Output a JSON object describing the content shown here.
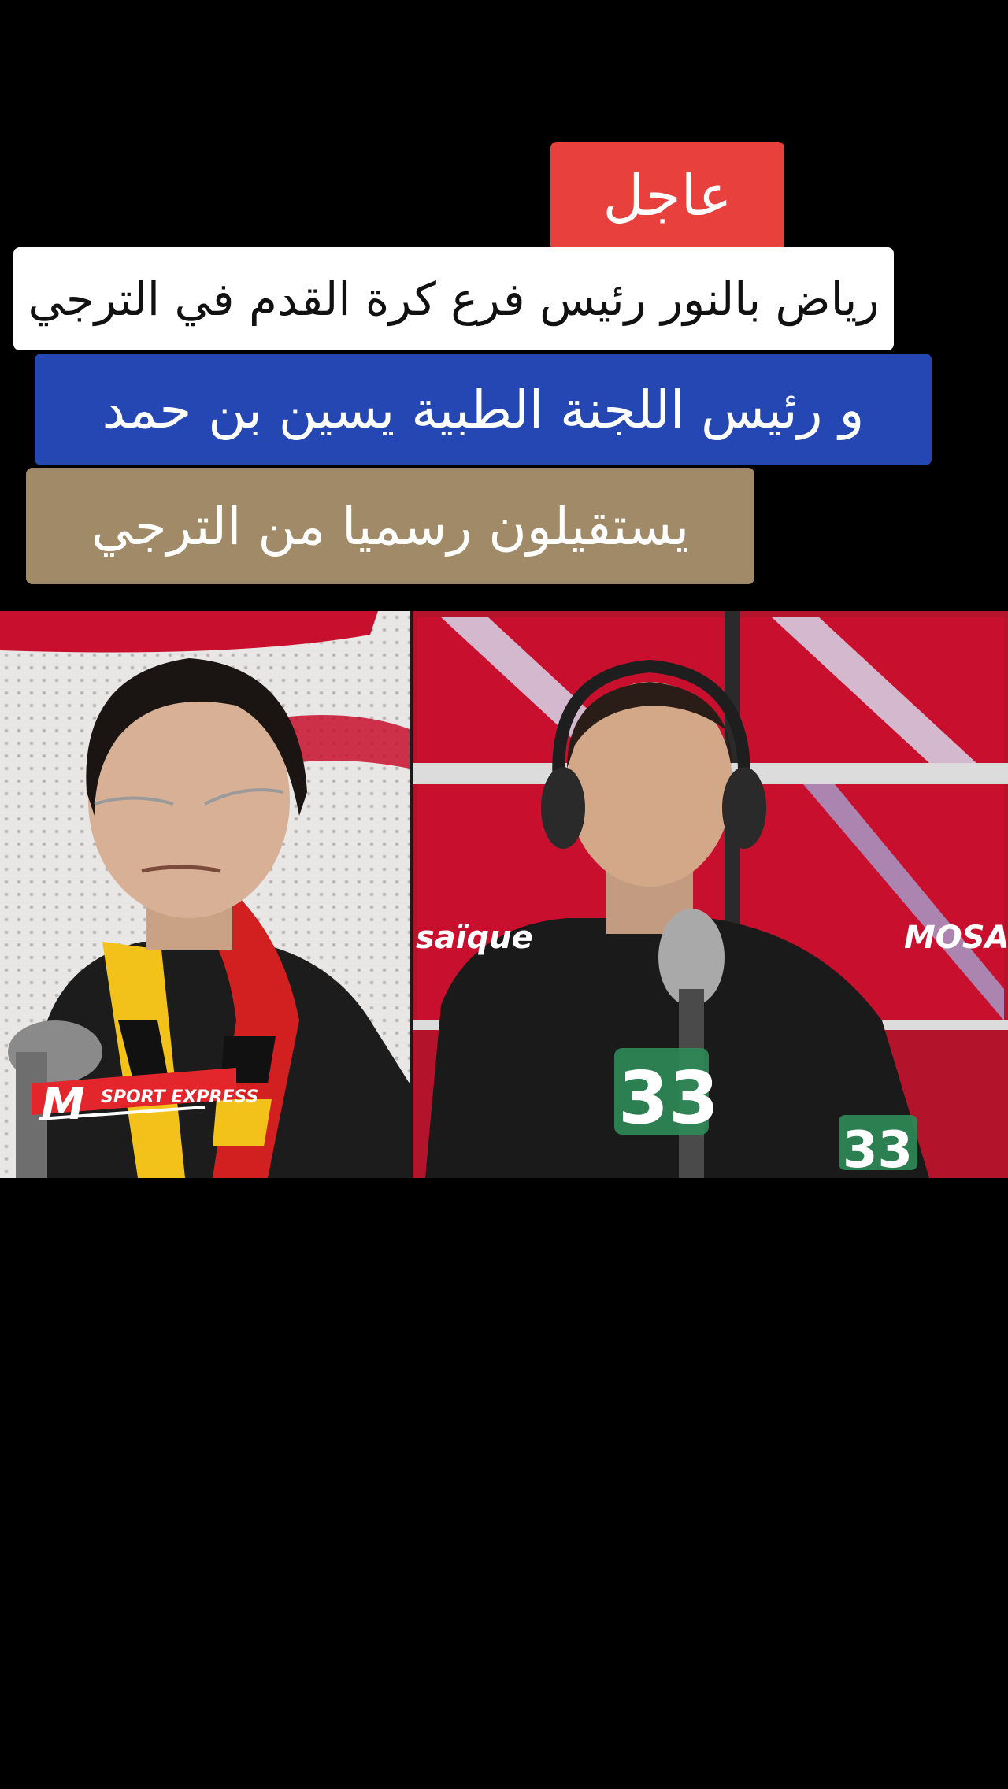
{
  "captions": {
    "urgent": "عاجل",
    "line1": "رياض بالنور رئيس فرع كرة القدم في الترجي",
    "line2": "و رئيس اللجنة الطبية يسين بن حمد",
    "line3": "يستقيلون رسميا من الترجي"
  },
  "video": {
    "watermark_brand": "SPORT EXPRESS",
    "watermark_letter": "M",
    "studio_wall_text_right": "MOSA",
    "studio_wall_text_mid": "saïque",
    "jersey_number": "33",
    "jersey_number_sleeve": "33"
  },
  "colors": {
    "background": "#000000",
    "urgent_bg": "#e8403d",
    "line1_bg": "#ffffff",
    "line2_bg": "#2447b3",
    "line3_bg": "#a08a67",
    "studio_red": "#c8102e",
    "jersey_green": "#2e8b57"
  }
}
